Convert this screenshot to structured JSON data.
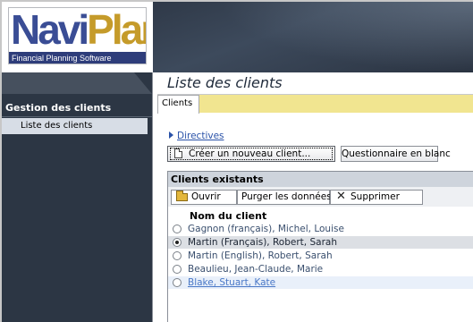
{
  "logo": {
    "name_part1": "Navi",
    "name_part2": "Plan",
    "tagline": "Financial Planning Software"
  },
  "sidebar": {
    "section_title": "Gestion des clients",
    "items": [
      {
        "label": "Liste des clients",
        "selected": true
      }
    ]
  },
  "main": {
    "title": "Liste des clients",
    "tabs": [
      {
        "label": "Clients",
        "active": true
      }
    ],
    "directives_link": "Directives",
    "buttons": {
      "create_client": "Créer un nouveau client...",
      "blank_questionnaire": "Questionnaire en blanc"
    },
    "existing_clients": {
      "header": "Clients existants",
      "toolbar": {
        "open": "Ouvrir",
        "purge": "Purger les données...",
        "delete": "Supprimer"
      },
      "column_header": "Nom du client",
      "rows": [
        {
          "name": "Gagnon (français), Michel, Louise",
          "selected": false
        },
        {
          "name": "Martin (Français), Robert, Sarah",
          "selected": true
        },
        {
          "name": "Martin (English), Robert, Sarah",
          "selected": false
        },
        {
          "name": "Beaulieu, Jean-Claude, Marie",
          "selected": false
        },
        {
          "name": "Blake, Stuart, Kate",
          "selected": false
        }
      ]
    }
  },
  "colors": {
    "sidebar_bg": "#2c3644",
    "tab_strip": "#f1e590",
    "link": "#2a52a8",
    "brand_blue": "#3a4d95",
    "brand_gold": "#c59b2a"
  },
  "icons": [
    "document-icon",
    "folder-open-icon",
    "x-delete-icon",
    "triangle-right-icon",
    "radio-icon"
  ]
}
